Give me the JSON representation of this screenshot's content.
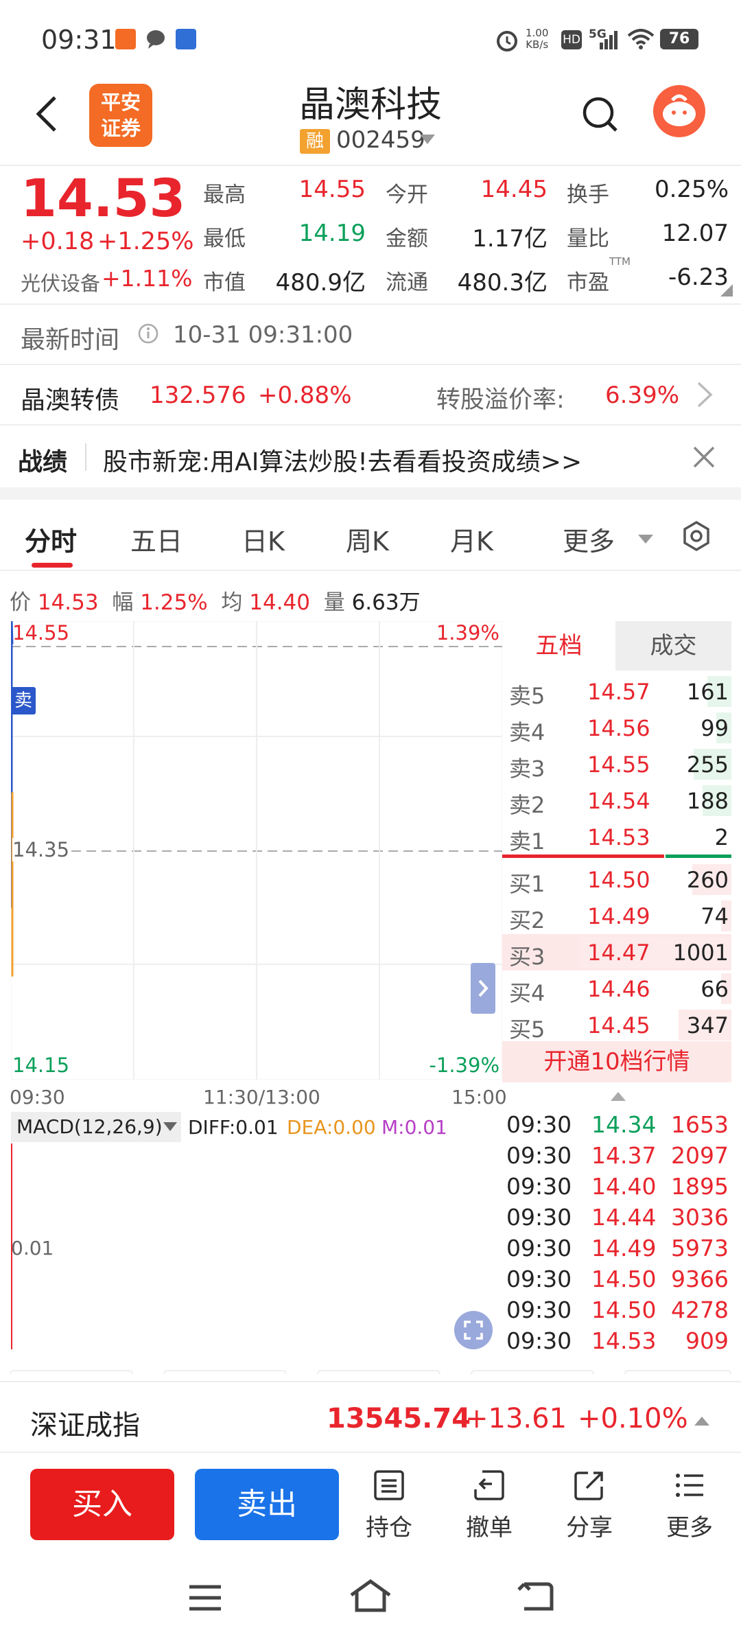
{
  "status": {
    "time": "09:31",
    "speed_top": "1.00",
    "speed_bottom": "KB/s",
    "hd": "HD",
    "net": "5G",
    "battery": "76"
  },
  "header": {
    "logo_line1": "平安",
    "logo_line2": "证券",
    "title": "晶澳科技",
    "rong": "融",
    "code": "002459"
  },
  "quote": {
    "price": "14.53",
    "change": "+0.18",
    "change_pct": "+1.25%",
    "sector": "光伏设备",
    "sector_pct": "+1.11%",
    "high_label": "最高",
    "high": "14.55",
    "low_label": "最低",
    "low": "14.19",
    "mcap_label": "市值",
    "mcap": "480.9亿",
    "open_label": "今开",
    "open": "14.45",
    "amount_label": "金额",
    "amount": "1.17亿",
    "float_label": "流通",
    "float": "480.3亿",
    "turnover_label": "换手",
    "turnover": "0.25%",
    "vol_ratio_label": "量比",
    "vol_ratio": "12.07",
    "pe_label": "市盈",
    "pe_sup": "TTM",
    "pe": "-6.23"
  },
  "latest": {
    "label": "最新时间",
    "time": "10-31 09:31:00"
  },
  "bond": {
    "name": "晶澳转债",
    "price": "132.576",
    "pct": "+0.88%",
    "premium_label": "转股溢价率:",
    "premium": "6.39%"
  },
  "banner": {
    "tag": "战绩",
    "text": "股市新宠:用AI算法炒股!去看看投资成绩>>"
  },
  "tabs": [
    "分时",
    "五日",
    "日K",
    "周K",
    "月K",
    "更多"
  ],
  "info": {
    "price_label": "价",
    "price": "14.53",
    "range_label": "幅",
    "range": "1.25%",
    "avg_label": "均",
    "avg": "14.40",
    "vol_label": "量",
    "vol": "6.63万"
  },
  "chart_data": {
    "type": "line",
    "y_top": "14.55",
    "y_mid": "14.35",
    "y_bottom": "14.15",
    "pct_top": "1.39%",
    "pct_bottom": "-1.39%",
    "x_labels": [
      "09:30",
      "11:30/13:00",
      "15:00"
    ],
    "ylim": [
      14.15,
      14.55
    ],
    "sell_marker": "卖",
    "macd_label": "MACD(12,26,9)",
    "diff": "DIFF:0.01",
    "dea": "DEA:0.00",
    "m": "M:0.01",
    "macd_axis": "0.01"
  },
  "orderbook": {
    "tab_five": "五档",
    "tab_trades": "成交",
    "asks": [
      {
        "label": "卖5",
        "price": "14.57",
        "vol": "161",
        "share": 0.16
      },
      {
        "label": "卖4",
        "price": "14.56",
        "vol": "99",
        "share": 0.1
      },
      {
        "label": "卖3",
        "price": "14.55",
        "vol": "255",
        "share": 0.25
      },
      {
        "label": "卖2",
        "price": "14.54",
        "vol": "188",
        "share": 0.19
      },
      {
        "label": "卖1",
        "price": "14.53",
        "vol": "2",
        "share": 0.0
      }
    ],
    "bids": [
      {
        "label": "买1",
        "price": "14.50",
        "vol": "260",
        "share": 0.26
      },
      {
        "label": "买2",
        "price": "14.49",
        "vol": "74",
        "share": 0.07
      },
      {
        "label": "买3",
        "price": "14.47",
        "vol": "1001",
        "share": 1.0
      },
      {
        "label": "买4",
        "price": "14.46",
        "vol": "66",
        "share": 0.07
      },
      {
        "label": "买5",
        "price": "14.45",
        "vol": "347",
        "share": 0.35
      }
    ],
    "upgrade": "开通10档行情"
  },
  "ticks": [
    {
      "time": "09:30",
      "price": "14.34",
      "vol": "1653",
      "pc": "green"
    },
    {
      "time": "09:30",
      "price": "14.37",
      "vol": "2097",
      "pc": "red"
    },
    {
      "time": "09:30",
      "price": "14.40",
      "vol": "1895",
      "pc": "red"
    },
    {
      "time": "09:30",
      "price": "14.44",
      "vol": "3036",
      "pc": "red"
    },
    {
      "time": "09:30",
      "price": "14.49",
      "vol": "5973",
      "pc": "red"
    },
    {
      "time": "09:30",
      "price": "14.50",
      "vol": "9366",
      "pc": "red"
    },
    {
      "time": "09:30",
      "price": "14.50",
      "vol": "4278",
      "pc": "red"
    },
    {
      "time": "09:30",
      "price": "14.53",
      "vol": "909",
      "pc": "red"
    }
  ],
  "index": {
    "name": "深证成指",
    "value": "13545.74",
    "change": "+13.61",
    "pct": "+0.10%"
  },
  "actions": {
    "buy": "买入",
    "sell": "卖出",
    "position": "持仓",
    "cancel": "撤单",
    "share": "分享",
    "more": "更多"
  },
  "colors": {
    "red": "#e8252d",
    "green": "#0ba05a",
    "blue": "#1a73e8",
    "orange": "#f36b24"
  }
}
